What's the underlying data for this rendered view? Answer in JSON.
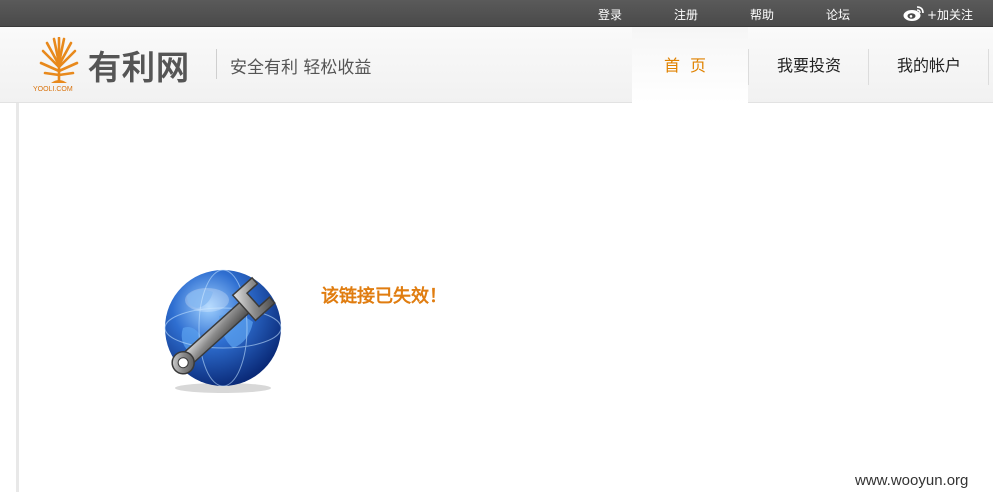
{
  "topbar": {
    "login": "登录",
    "register": "注册",
    "help": "帮助",
    "forum": "论坛",
    "follow": "+加关注"
  },
  "header": {
    "logo_name": "有利网",
    "logo_sub": "YOOLI.COM",
    "slogan": "安全有利  轻松收益"
  },
  "nav": {
    "home": "首页",
    "invest": "我要投资",
    "account": "我的帐户"
  },
  "main": {
    "message": "该链接已失效！"
  },
  "watermark": "www.wooyun.org",
  "colors": {
    "accent": "#e07d10",
    "topbar": "#4f4f4f",
    "text": "#222222"
  },
  "icons": {
    "weibo": "weibo-icon",
    "logo": "tree-logo-icon",
    "error": "globe-wrench-icon"
  }
}
